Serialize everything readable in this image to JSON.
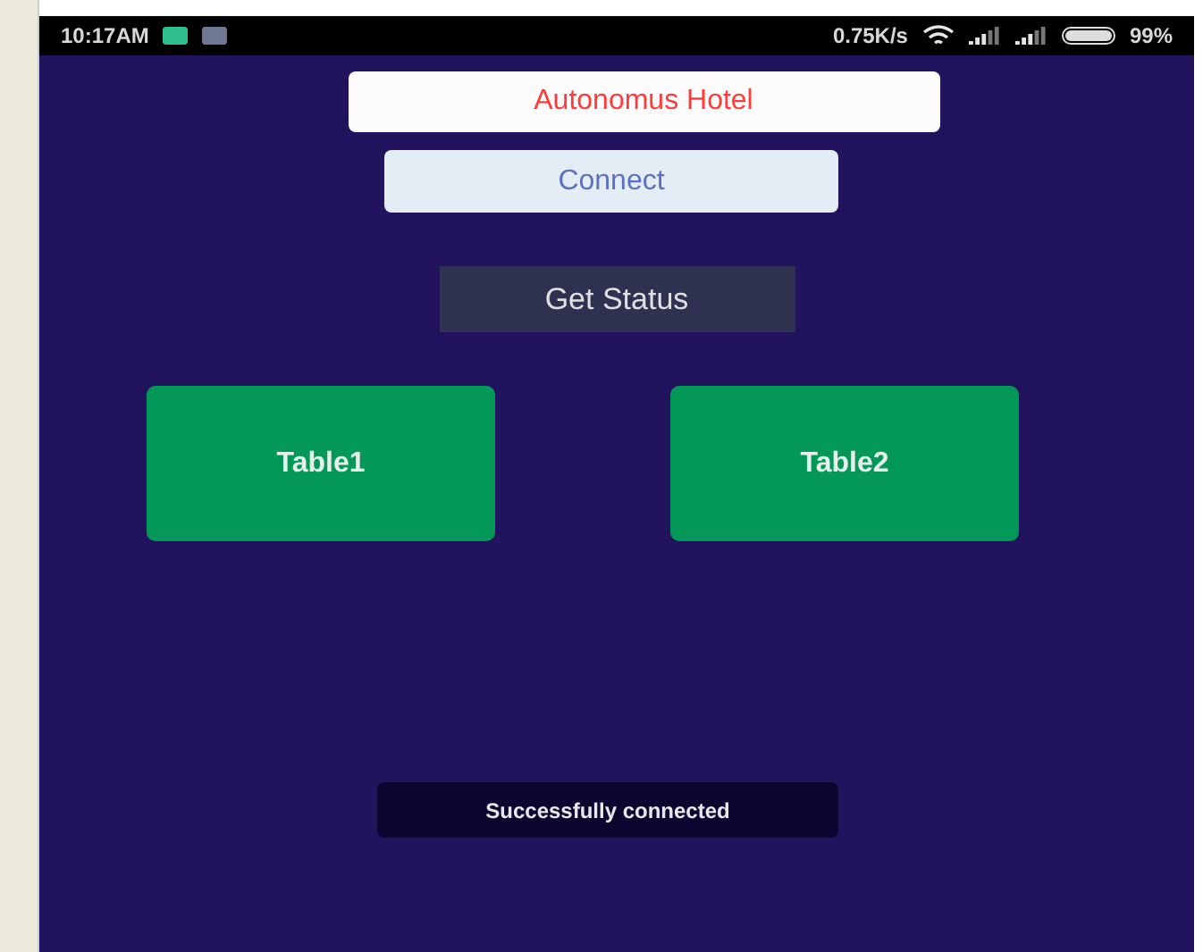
{
  "status_bar": {
    "time": "10:17AM",
    "speed": "0.75K/s",
    "battery": "99%"
  },
  "title": "Autonomus Hotel",
  "connect_button": "Connect",
  "status_button": "Get Status",
  "tables": [
    {
      "label": "Table1"
    },
    {
      "label": "Table2"
    }
  ],
  "toast": "Successfully connected"
}
